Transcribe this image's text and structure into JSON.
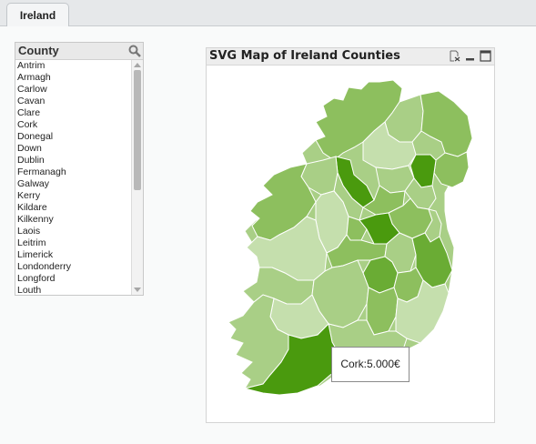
{
  "tab": {
    "label": "Ireland"
  },
  "listbox": {
    "title": "County",
    "items": [
      "Antrim",
      "Armagh",
      "Carlow",
      "Cavan",
      "Clare",
      "Cork",
      "Donegal",
      "Down",
      "Dublin",
      "Fermanagh",
      "Galway",
      "Kerry",
      "Kildare",
      "Kilkenny",
      "Laois",
      "Leitrim",
      "Limerick",
      "Londonderry",
      "Longford",
      "Louth"
    ]
  },
  "map": {
    "title": "SVG Map of Ireland Counties",
    "icons": [
      "clear-selection-icon",
      "minimize-icon",
      "maximize-icon"
    ],
    "tooltip": "Cork:5.000€",
    "colors": {
      "darkest": "#4a9a0e",
      "dark": "#6aac34",
      "medium": "#8dbf5e",
      "light": "#a9cf86",
      "lightest": "#c5dfad"
    }
  }
}
